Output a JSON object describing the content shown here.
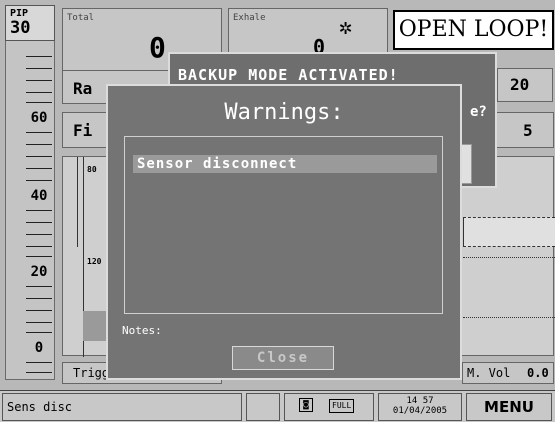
{
  "gauge": {
    "label": "PIP",
    "value": "30",
    "scale": [
      "60",
      "40",
      "20",
      "0"
    ]
  },
  "panels": {
    "total_label": "Total",
    "total_value": "0",
    "exhale_label": "Exhale",
    "exhale_value": "0",
    "rate_label": "Ra",
    "fi_label": "Fi",
    "value_20": "20",
    "value_5": "5",
    "chart_tick_top": "80",
    "chart_tick_mid": "120",
    "trigger_label": "Trigg",
    "m_vol_label": "M. Vol",
    "m_vol_value": "0.0"
  },
  "open_loop": "OPEN LOOP!",
  "backup_dialog": {
    "title": "BACKUP MODE ACTIVATED!",
    "question_suffix": "e?"
  },
  "warnings_dialog": {
    "title": "Warnings:",
    "items": [
      "Sensor disconnect"
    ],
    "notes_label": "Notes:",
    "close_label": "Close"
  },
  "status_bar": {
    "message": "Sens disc",
    "battery_label": "FULL",
    "time": "14 57",
    "date": "01/04/2005",
    "menu_label": "MENU"
  },
  "colors": {
    "dialog_bg": "#747474",
    "selection_bg": "#9a9a9a",
    "panel_bg": "#c6c6c6"
  }
}
